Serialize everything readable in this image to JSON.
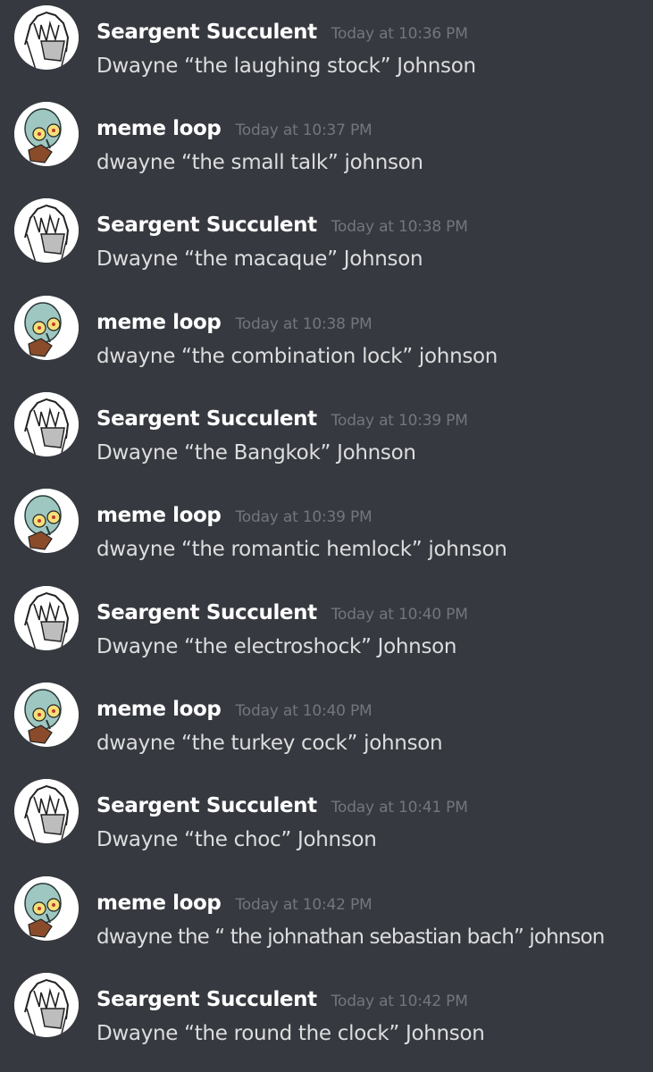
{
  "messages": [
    {
      "author": "Seargent Succulent",
      "avatar": "anime-character-avatar",
      "timestamp": "Today at 10:36 PM",
      "text": "Dwayne “the laughing stock” Johnson"
    },
    {
      "author": "meme loop",
      "avatar": "squidward-avatar",
      "timestamp": "Today at 10:37 PM",
      "text": "dwayne “the small talk” johnson"
    },
    {
      "author": "Seargent Succulent",
      "avatar": "anime-character-avatar",
      "timestamp": "Today at 10:38 PM",
      "text": "Dwayne “the macaque” Johnson"
    },
    {
      "author": "meme loop",
      "avatar": "squidward-avatar",
      "timestamp": "Today at 10:38 PM",
      "text": "dwayne “the combination lock” johnson"
    },
    {
      "author": "Seargent Succulent",
      "avatar": "anime-character-avatar",
      "timestamp": "Today at 10:39 PM",
      "text": "Dwayne “the Bangkok” Johnson"
    },
    {
      "author": "meme loop",
      "avatar": "squidward-avatar",
      "timestamp": "Today at 10:39 PM",
      "text": "dwayne “the romantic hemlock” johnson"
    },
    {
      "author": "Seargent Succulent",
      "avatar": "anime-character-avatar",
      "timestamp": "Today at 10:40 PM",
      "text": "Dwayne “the electroshock” Johnson"
    },
    {
      "author": "meme loop",
      "avatar": "squidward-avatar",
      "timestamp": "Today at 10:40 PM",
      "text": "dwayne “the turkey cock” johnson"
    },
    {
      "author": "Seargent Succulent",
      "avatar": "anime-character-avatar",
      "timestamp": "Today at 10:41 PM",
      "text": "Dwayne “the choc” Johnson"
    },
    {
      "author": "meme loop",
      "avatar": "squidward-avatar",
      "timestamp": "Today at 10:42 PM",
      "text": "dwayne the “ the johnathan sebastian bach” johnson"
    },
    {
      "author": "Seargent Succulent",
      "avatar": "anime-character-avatar",
      "timestamp": "Today at 10:42 PM",
      "text": "Dwayne “the round the clock” Johnson"
    }
  ],
  "colors": {
    "background": "#36393f",
    "author": "#ffffff",
    "timestamp": "#72767d",
    "message_text": "#dcddde"
  }
}
